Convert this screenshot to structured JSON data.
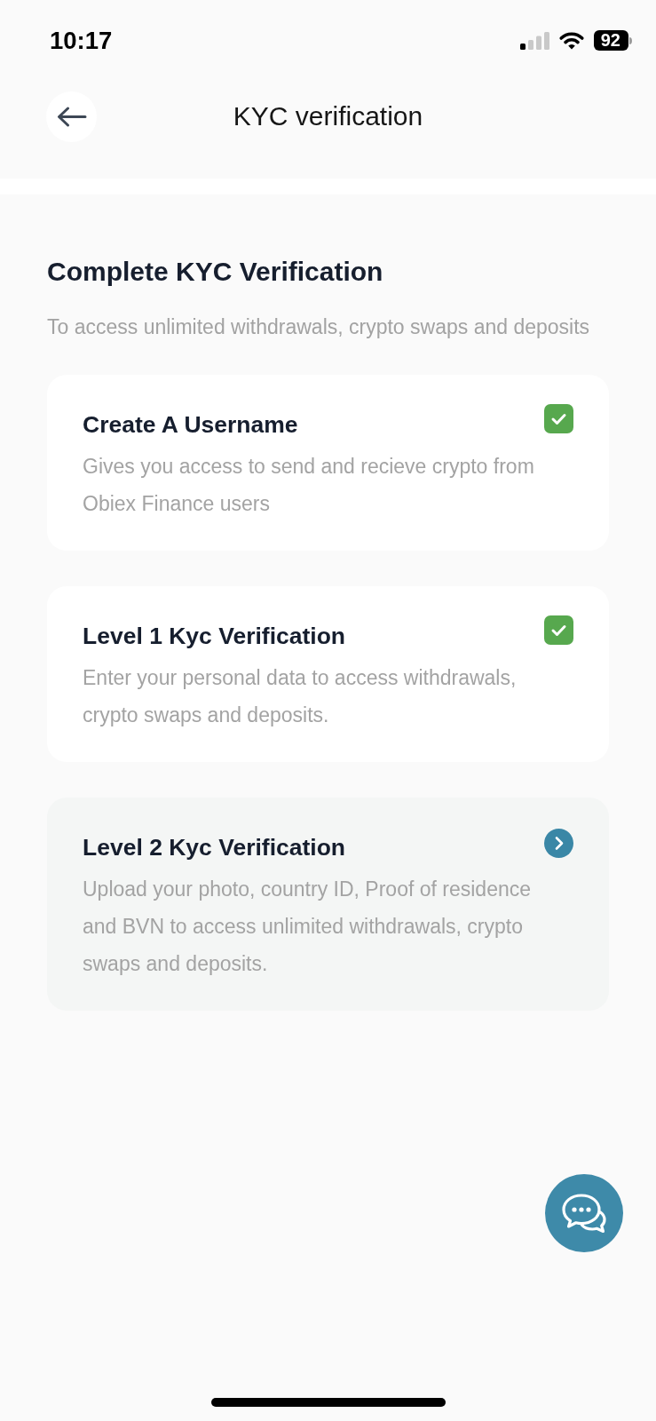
{
  "status_bar": {
    "time": "10:17",
    "battery": "92"
  },
  "header": {
    "title": "KYC verification"
  },
  "intro": {
    "heading": "Complete KYC Verification",
    "subtitle": "To access unlimited withdrawals, crypto swaps and deposits"
  },
  "steps": [
    {
      "title": "Create A Username",
      "description": "Gives you access to send and recieve crypto from Obiex Finance users",
      "completed": true
    },
    {
      "title": "Level 1 Kyc Verification",
      "description": "Enter your personal data to access withdrawals, crypto swaps and deposits.",
      "completed": true
    },
    {
      "title": "Level 2 Kyc Verification",
      "description": "Upload your photo, country ID, Proof of residence and BVN to access unlimited withdrawals, crypto swaps and deposits.",
      "completed": false
    }
  ]
}
